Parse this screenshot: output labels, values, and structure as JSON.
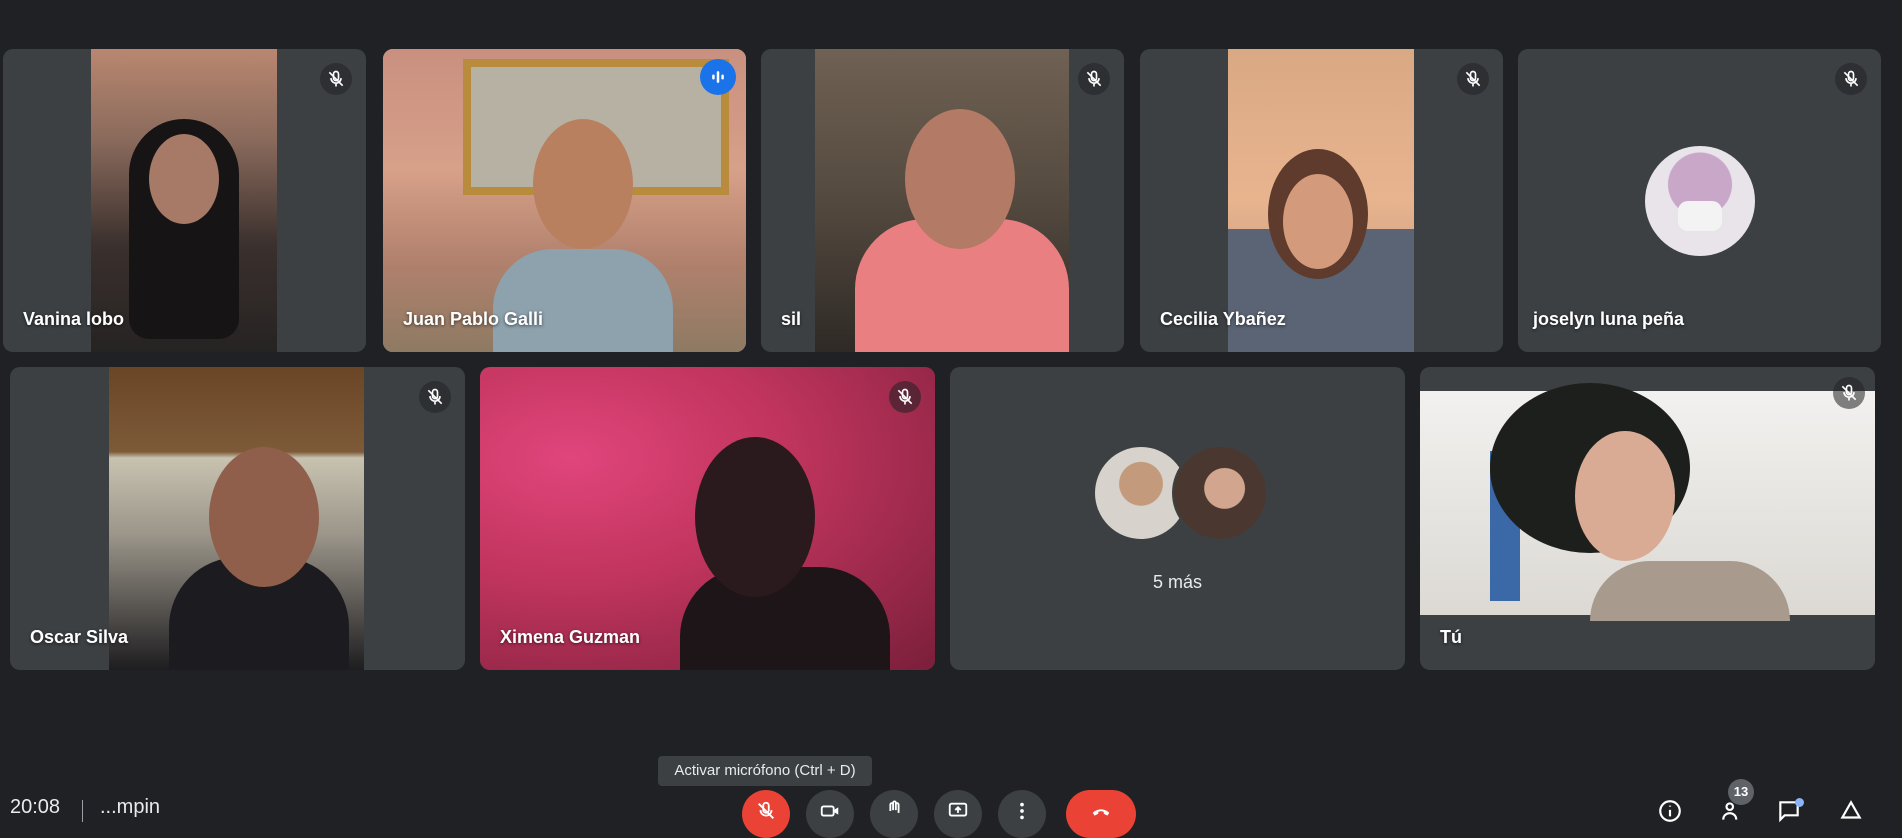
{
  "participants": [
    {
      "name": "Vanina lobo",
      "mic": "muted"
    },
    {
      "name": "Juan Pablo Galli",
      "mic": "speaking"
    },
    {
      "name": "sil",
      "mic": "muted"
    },
    {
      "name": "Cecilia Ybañez",
      "mic": "muted"
    },
    {
      "name": "joselyn luna peña",
      "mic": "muted"
    },
    {
      "name": "Oscar Silva",
      "mic": "muted"
    },
    {
      "name": "Ximena Guzman",
      "mic": "muted"
    },
    {
      "name": "Tú",
      "mic": "muted"
    }
  ],
  "overflow_tile": {
    "label": "5 más"
  },
  "tooltip": "Activar micrófono (Ctrl + D)",
  "bottom_bar": {
    "time": "20:08",
    "meeting_code": "...mpin",
    "participants_count": "13"
  },
  "icons": {
    "mic_off": "mic-off-icon",
    "speaking": "audio-level-icon",
    "camera": "camera-icon",
    "hand": "raise-hand-icon",
    "present": "present-screen-icon",
    "more": "more-vert-icon",
    "hangup": "hang-up-icon",
    "info": "info-icon",
    "people": "people-icon",
    "chat": "chat-icon",
    "activities": "activities-icon"
  },
  "colors": {
    "background": "#202124",
    "tile": "#3c4043",
    "speaking_outline": "#8ab4f8",
    "danger": "#ea4335"
  }
}
